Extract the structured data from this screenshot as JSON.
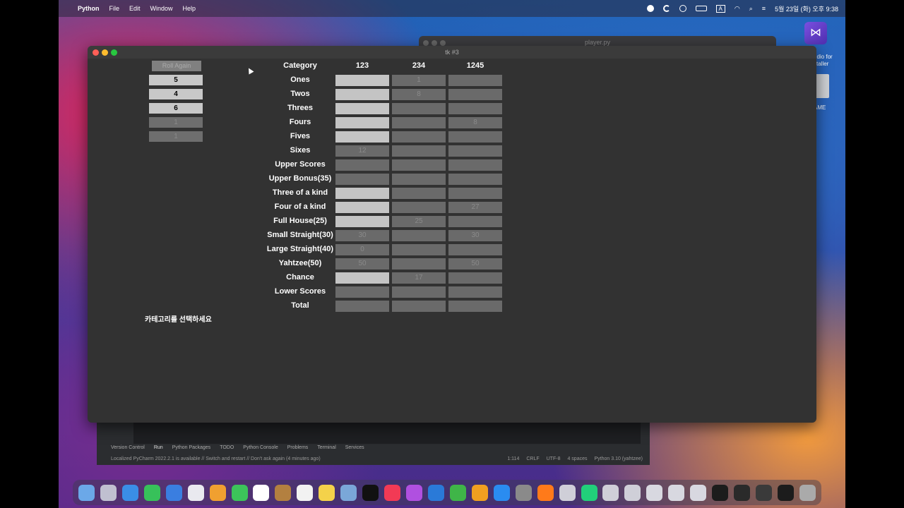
{
  "menubar": {
    "app": "Python",
    "items": [
      "File",
      "Edit",
      "Window",
      "Help"
    ],
    "datetime": "5월 23일 (화) 오후 9:38",
    "input_indicator": "A"
  },
  "background_window": {
    "title": "player.py"
  },
  "desktop": {
    "vs_label_line1": "udio for",
    "vs_label_line2": "staller",
    "drive_label": "AME"
  },
  "tk_window": {
    "title": "tk #3",
    "roll_button": "Roll Again",
    "dice": [
      {
        "value": "5",
        "held": true
      },
      {
        "value": "4",
        "held": true
      },
      {
        "value": "6",
        "held": true
      },
      {
        "value": "1",
        "held": false
      },
      {
        "value": "1",
        "held": false
      }
    ],
    "message": "카테고리를 선택하세요",
    "header": {
      "category": "Category",
      "players": [
        "123",
        "234",
        "1245"
      ]
    },
    "rows": [
      {
        "label": "Ones",
        "cells": [
          {
            "v": "",
            "s": "light"
          },
          {
            "v": "1",
            "s": "dark"
          },
          {
            "v": "",
            "s": "dark"
          }
        ]
      },
      {
        "label": "Twos",
        "cells": [
          {
            "v": "",
            "s": "light"
          },
          {
            "v": "8",
            "s": "dark"
          },
          {
            "v": "",
            "s": "dark"
          }
        ]
      },
      {
        "label": "Threes",
        "cells": [
          {
            "v": "",
            "s": "light"
          },
          {
            "v": "",
            "s": "dark"
          },
          {
            "v": "",
            "s": "dark"
          }
        ]
      },
      {
        "label": "Fours",
        "cells": [
          {
            "v": "",
            "s": "light"
          },
          {
            "v": "",
            "s": "dark"
          },
          {
            "v": "8",
            "s": "dark"
          }
        ]
      },
      {
        "label": "Fives",
        "cells": [
          {
            "v": "",
            "s": "light"
          },
          {
            "v": "",
            "s": "dark"
          },
          {
            "v": "",
            "s": "dark"
          }
        ]
      },
      {
        "label": "Sixes",
        "cells": [
          {
            "v": "12",
            "s": "dark"
          },
          {
            "v": "",
            "s": "dark"
          },
          {
            "v": "",
            "s": "dark"
          }
        ]
      },
      {
        "label": "Upper Scores",
        "cells": [
          {
            "v": "",
            "s": "dark"
          },
          {
            "v": "",
            "s": "dark"
          },
          {
            "v": "",
            "s": "dark"
          }
        ]
      },
      {
        "label": "Upper Bonus(35)",
        "cells": [
          {
            "v": "",
            "s": "dark"
          },
          {
            "v": "",
            "s": "dark"
          },
          {
            "v": "",
            "s": "dark"
          }
        ]
      },
      {
        "label": "Three of a kind",
        "cells": [
          {
            "v": "",
            "s": "light"
          },
          {
            "v": "",
            "s": "dark"
          },
          {
            "v": "",
            "s": "dark"
          }
        ]
      },
      {
        "label": "Four of a kind",
        "cells": [
          {
            "v": "",
            "s": "light"
          },
          {
            "v": "",
            "s": "dark"
          },
          {
            "v": "27",
            "s": "dark"
          }
        ]
      },
      {
        "label": "Full House(25)",
        "cells": [
          {
            "v": "",
            "s": "light"
          },
          {
            "v": "25",
            "s": "dark"
          },
          {
            "v": "",
            "s": "dark"
          }
        ]
      },
      {
        "label": "Small Straight(30)",
        "cells": [
          {
            "v": "30",
            "s": "dark"
          },
          {
            "v": "",
            "s": "dark"
          },
          {
            "v": "30",
            "s": "dark"
          }
        ]
      },
      {
        "label": "Large Straight(40)",
        "cells": [
          {
            "v": "0",
            "s": "dark"
          },
          {
            "v": "",
            "s": "dark"
          },
          {
            "v": "",
            "s": "dark"
          }
        ]
      },
      {
        "label": "Yahtzee(50)",
        "cells": [
          {
            "v": "50",
            "s": "dark"
          },
          {
            "v": "",
            "s": "dark"
          },
          {
            "v": "50",
            "s": "dark"
          }
        ]
      },
      {
        "label": "Chance",
        "cells": [
          {
            "v": "",
            "s": "light"
          },
          {
            "v": "17",
            "s": "dark"
          },
          {
            "v": "",
            "s": "dark"
          }
        ]
      },
      {
        "label": "Lower Scores",
        "cells": [
          {
            "v": "",
            "s": "dark"
          },
          {
            "v": "",
            "s": "dark"
          },
          {
            "v": "",
            "s": "dark"
          }
        ]
      },
      {
        "label": "Total",
        "cells": [
          {
            "v": "",
            "s": "dark"
          },
          {
            "v": "",
            "s": "dark"
          },
          {
            "v": "",
            "s": "dark"
          }
        ]
      }
    ]
  },
  "pycharm": {
    "tabs": [
      "Version Control",
      "Run",
      "Python Packages",
      "TODO",
      "Python Console",
      "Problems",
      "Terminal",
      "Services"
    ],
    "active_tab": "Run",
    "status": "Localized PyCharm 2022.2.1 is available // Switch and restart // Don't ask again (4 minutes ago)",
    "status_right": [
      "1:114",
      "CRLF",
      "UTF-8",
      "4 spaces",
      "Python 3.10 (yahtzee)"
    ]
  },
  "dock": {
    "colors": [
      "#6ba8e8",
      "#c0c0d0",
      "#3a8ee6",
      "#37c15a",
      "#3a7ee0",
      "#e9e9ef",
      "#f0a030",
      "#3cc45a",
      "#ffffff",
      "#b38040",
      "#f2f2f2",
      "#f4d24a",
      "#7aa7d8",
      "#111111",
      "#f23a55",
      "#b050e0",
      "#2a7ad8",
      "#3fb548",
      "#f0a020",
      "#2a8cf0",
      "#8a8a8a",
      "#ff7a1a",
      "#cfcfd8",
      "#21d07a",
      "#cfcfd8",
      "#cfcfd8",
      "#d8d8e0",
      "#d8d8e0",
      "#d8d8e0",
      "#1c1c1c",
      "#2a2a2a",
      "#3a3a3a",
      "#1c1c1c",
      "#aaaaaa"
    ]
  }
}
